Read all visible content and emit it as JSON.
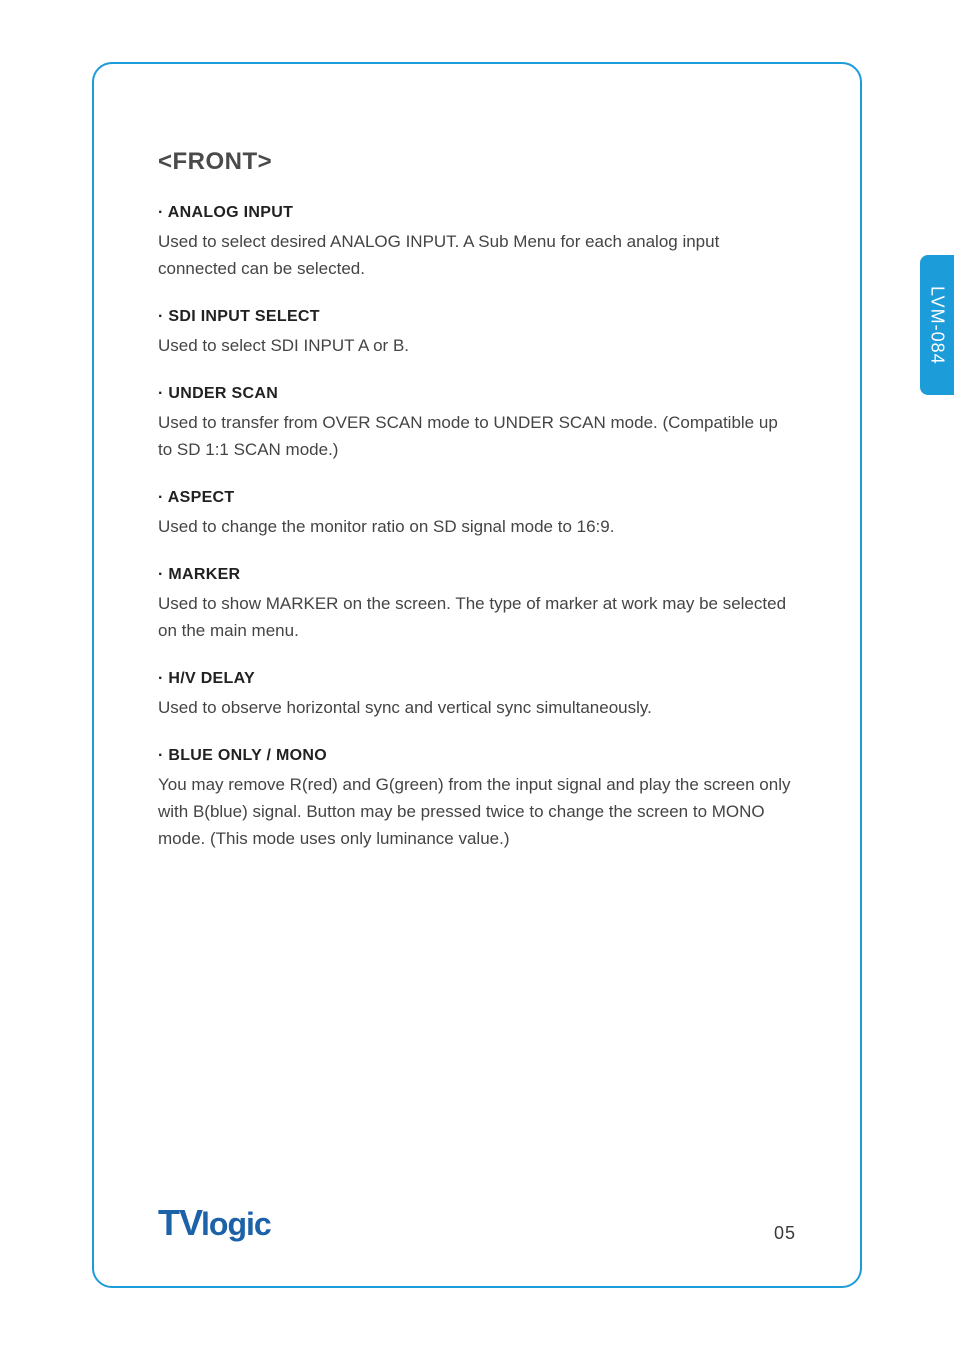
{
  "side_tab": "LVM-084",
  "title": "<FRONT>",
  "sections": [
    {
      "title": "· ANALOG INPUT",
      "desc": "Used to select desired ANALOG INPUT. A Sub Menu for each analog input connected can be selected."
    },
    {
      "title": "· SDI INPUT SELECT",
      "desc": "Used to select SDI INPUT A or B."
    },
    {
      "title": "· UNDER SCAN",
      "desc": "Used to transfer from OVER SCAN mode to UNDER SCAN mode. (Compatible up to SD 1:1 SCAN mode.)"
    },
    {
      "title": "· ASPECT",
      "desc": "Used to change the monitor ratio on SD signal mode to 16:9."
    },
    {
      "title": "· MARKER",
      "desc": "Used to show MARKER on the screen. The type of marker at work may be selected on the main menu."
    },
    {
      "title": "· H/V DELAY",
      "desc": "Used to observe horizontal sync and vertical sync simultaneously."
    },
    {
      "title": "· BLUE ONLY / MONO",
      "desc": "You may remove R(red) and G(green) from the input signal and play the screen only with B(blue) signal. Button may be pressed twice to change the screen to MONO mode. (This mode uses only luminance value.)"
    }
  ],
  "logo": {
    "part1": "TV",
    "part2": "logic"
  },
  "page_number": "05"
}
